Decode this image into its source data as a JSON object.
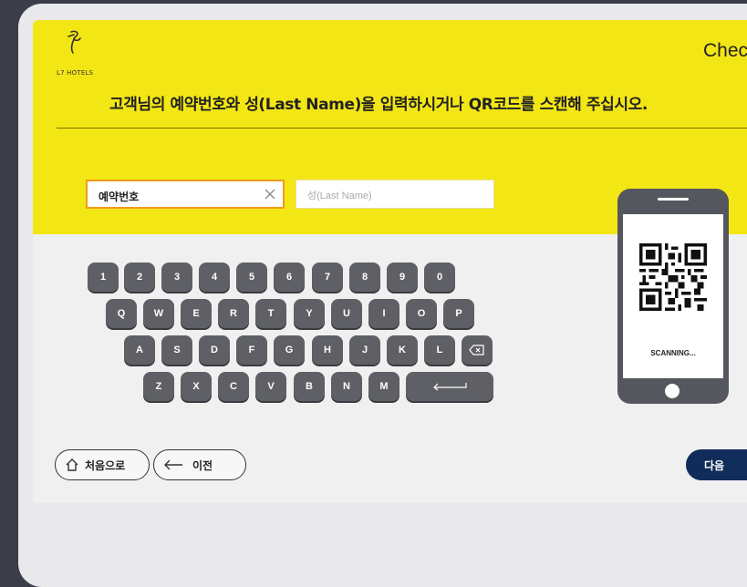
{
  "header": {
    "logo_text": "L7 HOTELS",
    "title": "Chec",
    "instruction": "고객님의 예약번호와 성(Last Name)을 입력하시거나 QR코드를 스캔해 주십시오."
  },
  "form": {
    "reservation_value": "예약번호",
    "lastname_placeholder": "성(Last Name)"
  },
  "keyboard": {
    "row1": [
      "1",
      "2",
      "3",
      "4",
      "5",
      "6",
      "7",
      "8",
      "9",
      "0"
    ],
    "row2": [
      "Q",
      "W",
      "E",
      "R",
      "T",
      "Y",
      "U",
      "I",
      "O",
      "P"
    ],
    "row3": [
      "A",
      "S",
      "D",
      "F",
      "G",
      "H",
      "J",
      "K",
      "L"
    ],
    "row4": [
      "Z",
      "X",
      "C",
      "V",
      "B",
      "N",
      "M"
    ]
  },
  "scanner": {
    "status": "SCANNING..."
  },
  "nav": {
    "home_label": "처음으로",
    "prev_label": "이전",
    "next_label": "다음"
  },
  "colors": {
    "header_bg": "#f3e615",
    "key_bg": "#5f6066",
    "active_border": "#f29a17",
    "next_btn": "#0f2c5a"
  }
}
